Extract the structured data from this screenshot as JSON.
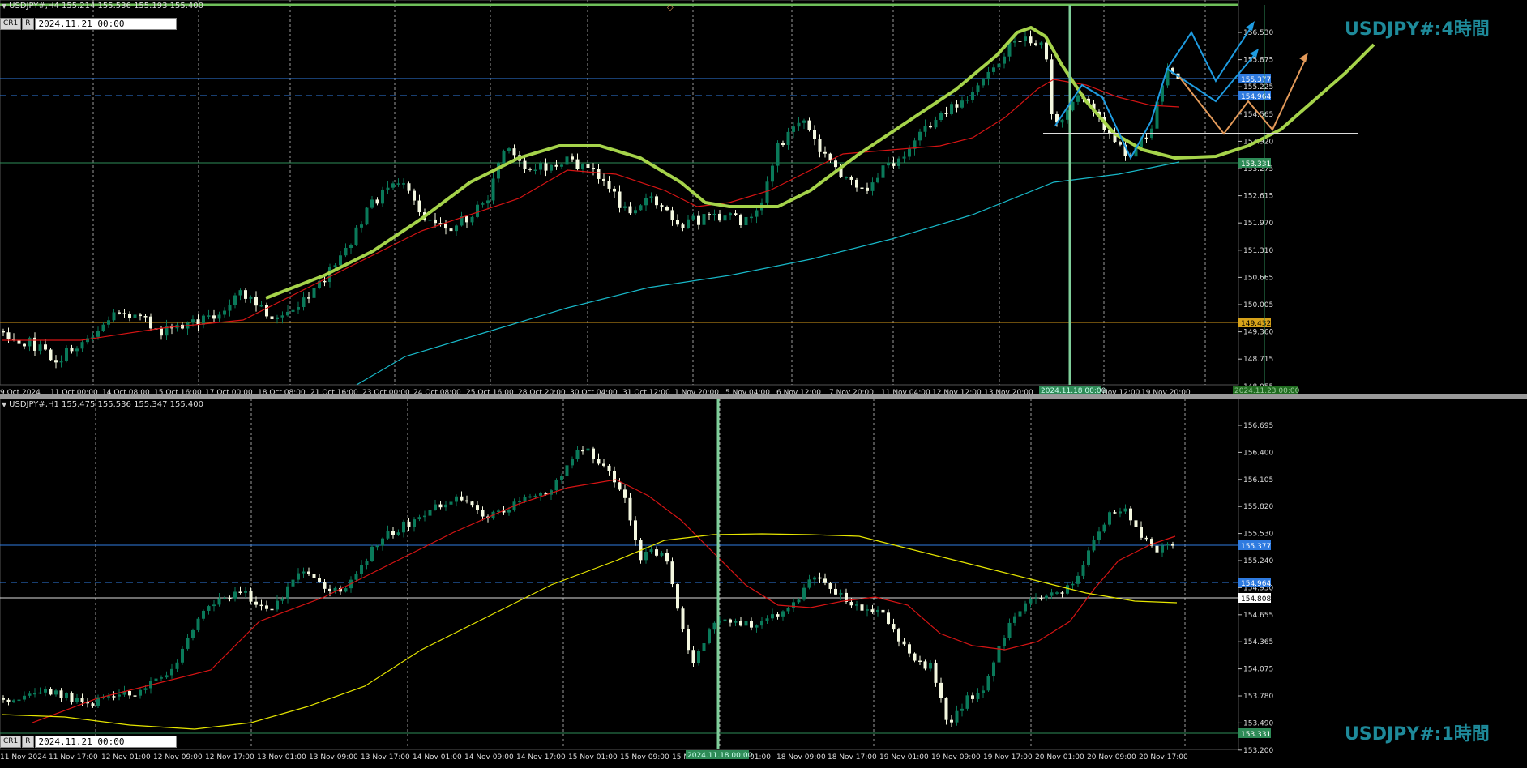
{
  "top": {
    "header": "USDJPY#,H4  155.214 155.536 155.193 155.400",
    "btn_c": "CR1",
    "btn_r": "R",
    "date_box": "2024.11.21 00:00",
    "title": "USDJPY#:4時間",
    "price_ticks": [
      "156.530",
      "155.875",
      "155.225",
      "154.565",
      "153.920",
      "153.275",
      "152.615",
      "151.970",
      "151.310",
      "150.665",
      "150.005",
      "149.360",
      "148.715",
      "148.055"
    ],
    "highlight_labels": [
      "155.377",
      "154.964",
      "153.331",
      "149.432"
    ],
    "time_labels": [
      "9 Oct 2024",
      "11 Oct 00:00",
      "14 Oct 08:00",
      "15 Oct 16:00",
      "17 Oct 00:00",
      "18 Oct 08:00",
      "21 Oct 16:00",
      "23 Oct 00:00",
      "24 Oct 08:00",
      "25 Oct 16:00",
      "28 Oct 20:00",
      "30 Oct 04:00",
      "31 Oct 12:00",
      "1 Nov 20:00",
      "5 Nov 04:00",
      "6 Nov 12:00",
      "7 Nov 20:00",
      "11 Nov 04:00",
      "12 Nov 12:00",
      "13 Nov 20:00",
      "Nov 12:00",
      "19 Nov 20:00"
    ],
    "marker_labels": [
      "2024.11.18 00:00",
      "2024.11.23 00:00"
    ]
  },
  "bottom": {
    "header": "USDJPY#,H1  155.475 155.536 155.347 155.400",
    "btn_c": "CR1",
    "btn_r": "R",
    "date_box": "2024.11.21 00:00",
    "title": "USDJPY#:1時間",
    "price_ticks": [
      "156.695",
      "156.400",
      "156.105",
      "155.820",
      "155.530",
      "155.240",
      "154.950",
      "154.655",
      "154.365",
      "154.075",
      "153.780",
      "153.490",
      "153.200"
    ],
    "highlight_labels": [
      "155.377",
      "154.964",
      "154.808",
      "153.331"
    ],
    "time_labels": [
      "11 Nov 2024",
      "11 Nov 17:00",
      "12 Nov 01:00",
      "12 Nov 09:00",
      "12 Nov 17:00",
      "13 Nov 01:00",
      "13 Nov 09:00",
      "13 Nov 17:00",
      "14 Nov 01:00",
      "14 Nov 09:00",
      "14 Nov 17:00",
      "15 Nov 01:00",
      "15 Nov 09:00",
      "15 N",
      "01:00",
      "18 Nov 09:00",
      "18 Nov 17:00",
      "19 Nov 01:00",
      "19 Nov 09:00",
      "19 Nov 17:00",
      "20 Nov 01:00",
      "20 Nov 09:00",
      "20 Nov 17:00"
    ],
    "marker_labels": [
      "2024.11.18 00:00"
    ]
  },
  "colors": {
    "bull": "#0a7a5a",
    "bear": "#f4f8e0",
    "ma_red": "#d61414",
    "ma_cyan": "#18b8c8",
    "ma_yellow": "#e6e600",
    "hand_line": "#a5d34a",
    "blue_level": "#2f7be0",
    "green_level": "#2e8b57",
    "orange_level": "#d69a1a",
    "white_level": "#dddddd",
    "arrow_blue": "#1e9be0",
    "arrow_orange": "#e39a5a",
    "title": "#1e8a9a"
  }
}
